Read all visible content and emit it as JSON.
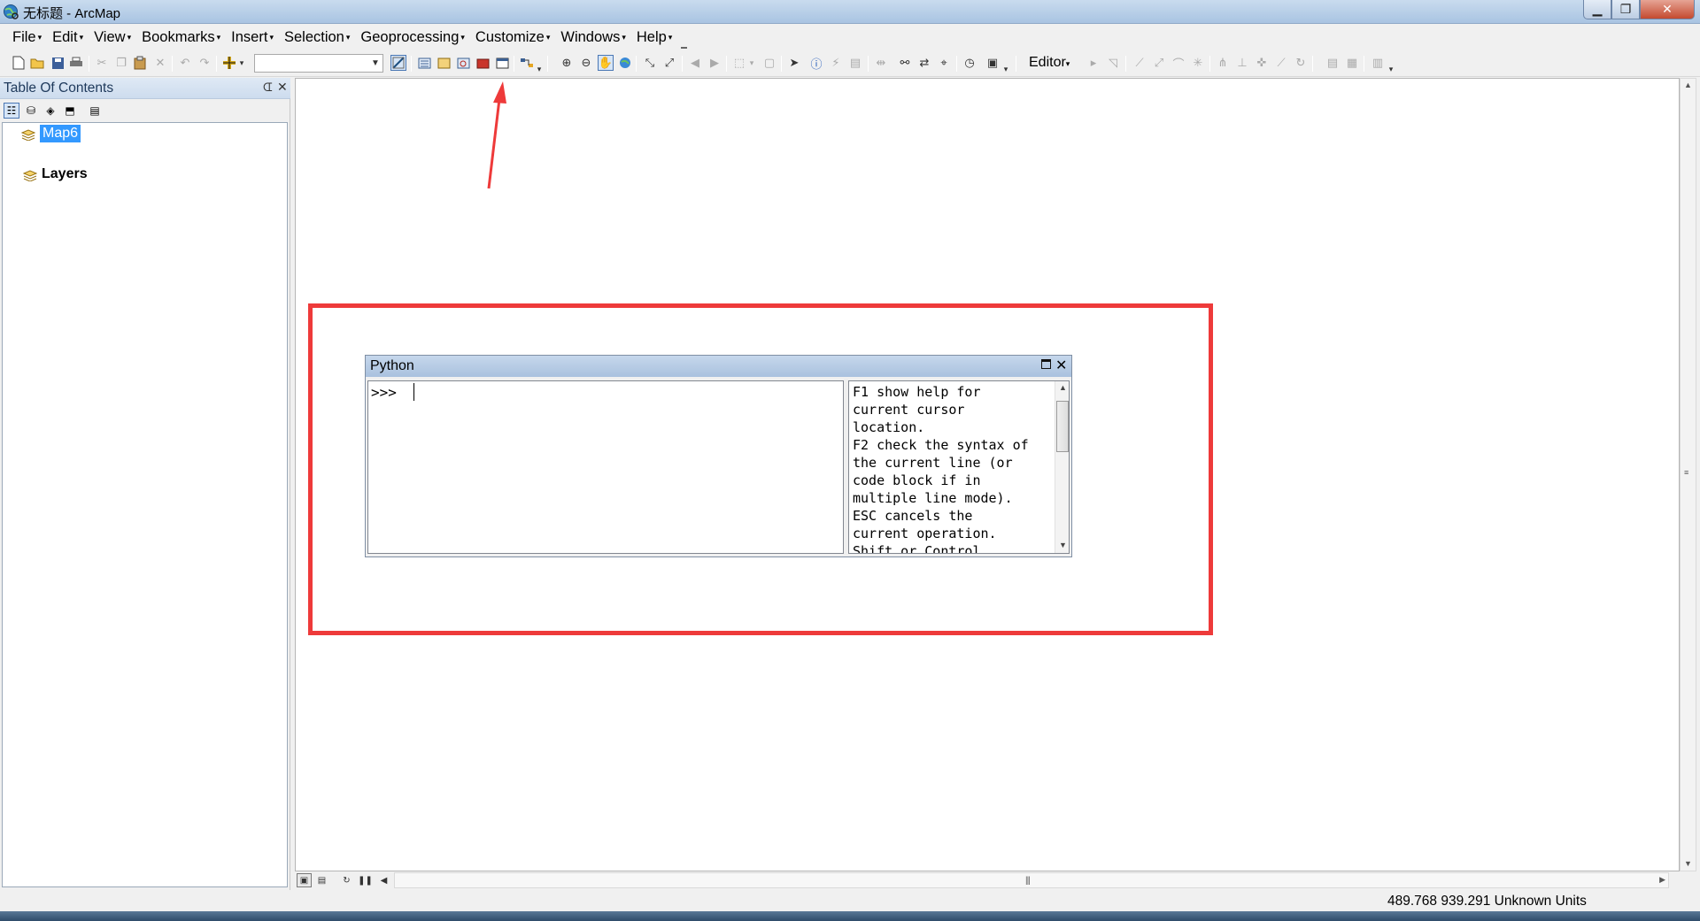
{
  "window": {
    "title": "无标题 - ArcMap",
    "minimize_glyph": "▁",
    "maximize_glyph": "❐",
    "close_glyph": "✕"
  },
  "menubar": {
    "items": [
      {
        "label": "File"
      },
      {
        "label": "Edit"
      },
      {
        "label": "View"
      },
      {
        "label": "Bookmarks"
      },
      {
        "label": "Insert"
      },
      {
        "label": "Selection"
      },
      {
        "label": "Geoprocessing"
      },
      {
        "label": "Customize"
      },
      {
        "label": "Windows"
      },
      {
        "label": "Help"
      }
    ],
    "caret": "▾"
  },
  "toolbar": {
    "scale_value": "",
    "editor_label": "Editor",
    "editor_caret": "▾",
    "active_tool": "python-window-button"
  },
  "toc": {
    "title": "Table Of Contents",
    "pin_glyph": "ᗭ",
    "close_glyph": "✕",
    "items": [
      {
        "label": "Map6",
        "selected": true
      },
      {
        "label": "Layers",
        "bold": true
      }
    ]
  },
  "python_window": {
    "title": "Python",
    "prompt": ">>>",
    "help_text": "F1 show help for\ncurrent cursor\nlocation.\nF2 check the syntax of\nthe current line (or\ncode block if in\nmultiple line mode).\nESC cancels the\ncurrent operation.\nShift or Control"
  },
  "status": {
    "coordinates": "489.768  939.291 Unknown Units"
  },
  "colors": {
    "annotation": "#ee3a3a",
    "selection": "#3399ff",
    "title_gradient": "#c6d7ec"
  }
}
